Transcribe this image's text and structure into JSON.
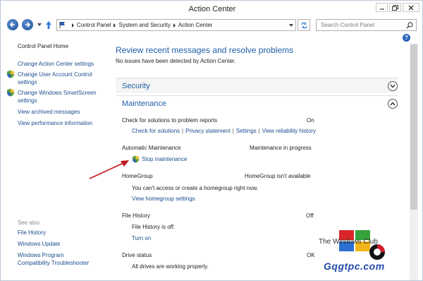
{
  "window": {
    "title": "Action Center"
  },
  "address": {
    "crumbs": [
      "Control Panel",
      "System and Security",
      "Action Center"
    ]
  },
  "search": {
    "placeholder": "Search Control Panel"
  },
  "sidebar": {
    "home": "Control Panel Home",
    "items": [
      {
        "label_line1": "Change Action Center settings",
        "label_line2": "",
        "shield": false
      },
      {
        "label_line1": "Change User Account Control",
        "label_line2": "settings",
        "shield": true
      },
      {
        "label_line1": "Change Windows SmartScreen",
        "label_line2": "settings",
        "shield": true
      },
      {
        "label_line1": "View archived messages",
        "label_line2": "",
        "shield": false
      },
      {
        "label_line1": "View performance information",
        "label_line2": "",
        "shield": false
      }
    ],
    "see_also_label": "See also",
    "see_also": [
      {
        "label_line1": "File History",
        "label_line2": ""
      },
      {
        "label_line1": "Windows Update",
        "label_line2": ""
      },
      {
        "label_line1": "Windows Program",
        "label_line2": "Compatibility Troubleshooter"
      }
    ]
  },
  "main": {
    "heading": "Review recent messages and resolve problems",
    "subtext": "No issues have been detected by Action Center.",
    "sections": {
      "security": "Security",
      "maintenance": "Maintenance"
    },
    "check_solutions": {
      "label": "Check for solutions to problem reports",
      "status": "On",
      "links": [
        "Check for solutions",
        "Privacy statement",
        "Settings",
        "View reliability history"
      ]
    },
    "auto_maintenance": {
      "label": "Automatic Maintenance",
      "status": "Maintenance in progress",
      "action": "Stop maintenance"
    },
    "homegroup": {
      "label": "HomeGroup",
      "status": "HomeGroup isn't available",
      "desc": "You can't access or create a homegroup right now.",
      "link": "View homegroup settings"
    },
    "file_history": {
      "label": "File History",
      "status": "Off",
      "desc": "File History is off.",
      "link": "Turn on"
    },
    "drive_status": {
      "label": "Drive status",
      "status": "OK",
      "desc": "All drives are working properly."
    }
  },
  "help_glyph": "?",
  "watermark": {
    "text": "The Windows Club",
    "site": "Gqgtpc.com"
  },
  "colors": {
    "link": "#1b4d8f",
    "heading": "#1f5da8",
    "arrow": "#c0161c"
  }
}
